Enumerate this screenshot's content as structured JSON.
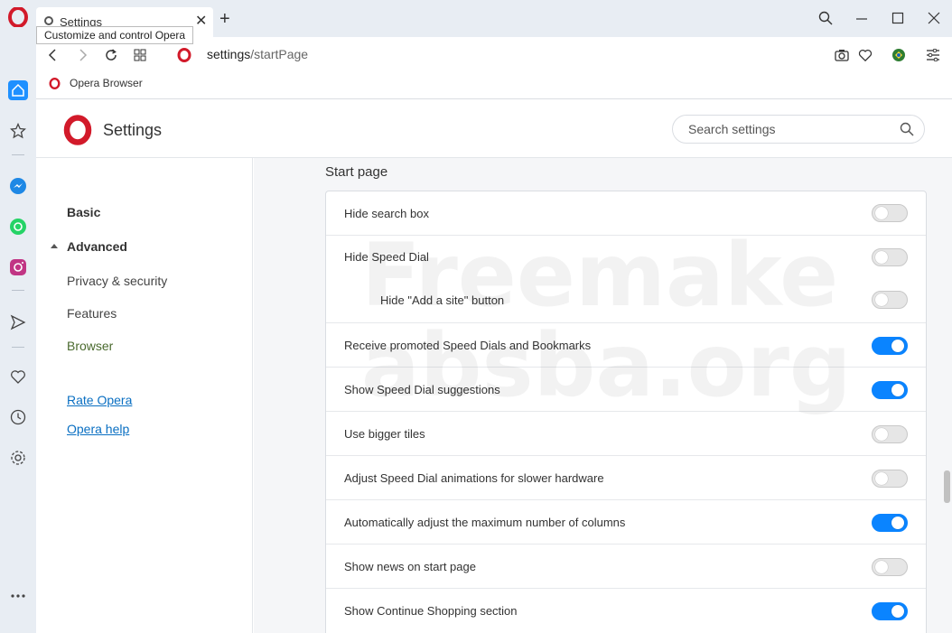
{
  "tab": {
    "title": "Settings"
  },
  "tooltip": "Customize and control Opera",
  "address": {
    "host": "settings",
    "path": "/startPage"
  },
  "bookmarks": [
    {
      "label": "Opera Browser"
    }
  ],
  "header": {
    "title": "Settings",
    "search_placeholder": "Search settings"
  },
  "nav": {
    "basic": "Basic",
    "advanced": "Advanced",
    "privacy": "Privacy & security",
    "features": "Features",
    "browser": "Browser",
    "rate": "Rate Opera",
    "help": "Opera help"
  },
  "section": {
    "title": "Start page",
    "rows": [
      {
        "label": "Hide search box",
        "on": false
      },
      {
        "label": "Hide Speed Dial",
        "on": false
      },
      {
        "label": "Hide \"Add a site\" button",
        "on": false
      },
      {
        "label": "Receive promoted Speed Dials and Bookmarks",
        "on": true
      },
      {
        "label": "Show Speed Dial suggestions",
        "on": true
      },
      {
        "label": "Use bigger tiles",
        "on": false
      },
      {
        "label": "Adjust Speed Dial animations for slower hardware",
        "on": false
      },
      {
        "label": "Automatically adjust the maximum number of columns",
        "on": true
      },
      {
        "label": "Show news on start page",
        "on": false
      },
      {
        "label": "Show Continue Shopping section",
        "on": true
      }
    ]
  },
  "watermark": {
    "line1": "Freemake",
    "line2": "absba.org"
  },
  "colors": {
    "accent": "#0a84ff",
    "opera_red": "#d21a2a",
    "sidebar": "#e8edf3"
  }
}
